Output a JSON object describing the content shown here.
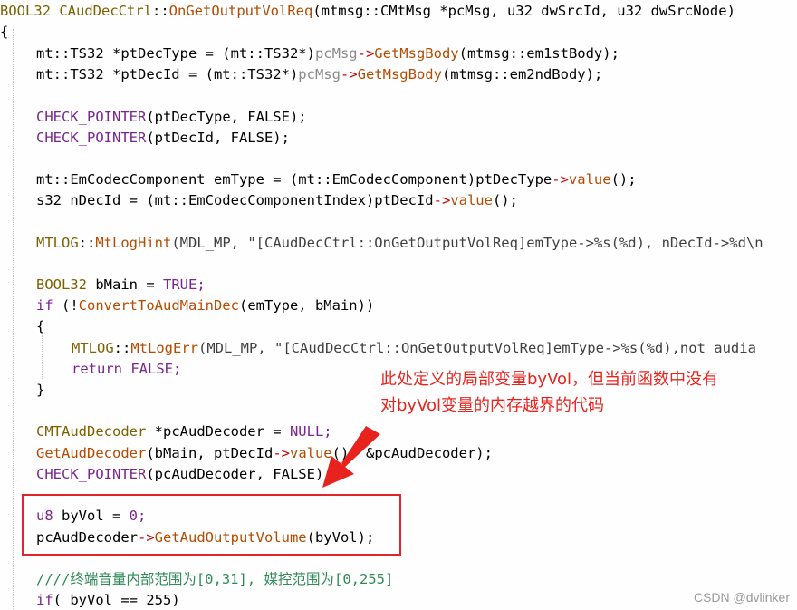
{
  "code": {
    "line1": {
      "type": "BOOL32",
      "cls": "CAudDecCtrl",
      "sep": "::",
      "fn": "OnGetOutputVolReq",
      "args": "(mtmsg::CMtMsg *pcMsg, u32 dwSrcId, u32 dwSrcNode)"
    },
    "line2": "{",
    "line3": {
      "pre": "mt::TS32 *ptDecType = (mt::TS32*)",
      "obj": "pcMsg",
      "arrow": "->",
      "fn": "GetMsgBody",
      "args": "(mtmsg::em1stBody);"
    },
    "line4": {
      "pre": "mt::TS32 *ptDecId = (mt::TS32*)",
      "obj": "pcMsg",
      "arrow": "->",
      "fn": "GetMsgBody",
      "args": "(mtmsg::em2ndBody);"
    },
    "line6": {
      "mac": "CHECK_POINTER",
      "args": "(ptDecType, FALSE);"
    },
    "line7": {
      "mac": "CHECK_POINTER",
      "args": "(ptDecId, FALSE);"
    },
    "line9": {
      "pre": "mt::EmCodecComponent emType = (mt::EmCodecComponent)ptDecType",
      "arrow": "->",
      "fn": "value",
      "post": "();"
    },
    "line10": {
      "pre": "s32 nDecId = (mt::EmCodecComponentIndex)ptDecId",
      "arrow": "->",
      "fn": "value",
      "post": "();"
    },
    "line12": {
      "kw": "MTLOG",
      "sep": "::",
      "fn": "MtLogHint",
      "args": "(MDL_MP, \"[CAudDecCtrl::OnGetOutputVolReq]emType->%s(%d), nDecId->%d\\n"
    },
    "line14": {
      "kw": "BOOL32",
      "pre": " bMain = ",
      "val": "TRUE;"
    },
    "line15": {
      "kw": "if",
      "pre": " (!",
      "fn": "ConvertToAudMainDec",
      "args": "(emType, bMain))"
    },
    "line16": "{",
    "line17": {
      "kw": "MTLOG",
      "sep": "::",
      "fn": "MtLogErr",
      "args": "(MDL_MP, \"[CAudDecCtrl::OnGetOutputVolReq]emType->%s(%d),not audia"
    },
    "line18": {
      "kw": "return",
      "args": " FALSE;"
    },
    "line19": "}",
    "line21": {
      "kw": "CMTAudDecoder",
      "pre": " *pcAudDecoder = ",
      "val": "NULL;"
    },
    "line22": {
      "fn": "GetAudDecoder",
      "pre": "(bMain, ptDecId",
      "arrow": "->",
      "fn2": "value",
      "post": "(), &pcAudDecoder);"
    },
    "line23": {
      "mac": "CHECK_POINTER",
      "args": "(pcAudDecoder, FALSE);"
    },
    "line25": {
      "kw": "u8",
      "pre": " byVol = ",
      "val": "0;"
    },
    "line26": {
      "pre": "pcAudDecoder",
      "arrow": "->",
      "fn": "GetAudOutputVolume",
      "args": "(byVol);"
    },
    "line28": "////终端音量内部范围为[0,31], 媒控范围为[0,255]",
    "line29": {
      "kw": "if",
      "args": "( byVol == 255)"
    }
  },
  "annotation": {
    "line1": "此处定义的局部变量byVol，但当前函数中没有",
    "line2": "对byVol变量的内存越界的代码"
  },
  "watermark": "CSDN @dvlinker",
  "colors": {
    "highlight_box": "#e0262a",
    "annotation": "#e8231d",
    "background": "#fefefe"
  }
}
